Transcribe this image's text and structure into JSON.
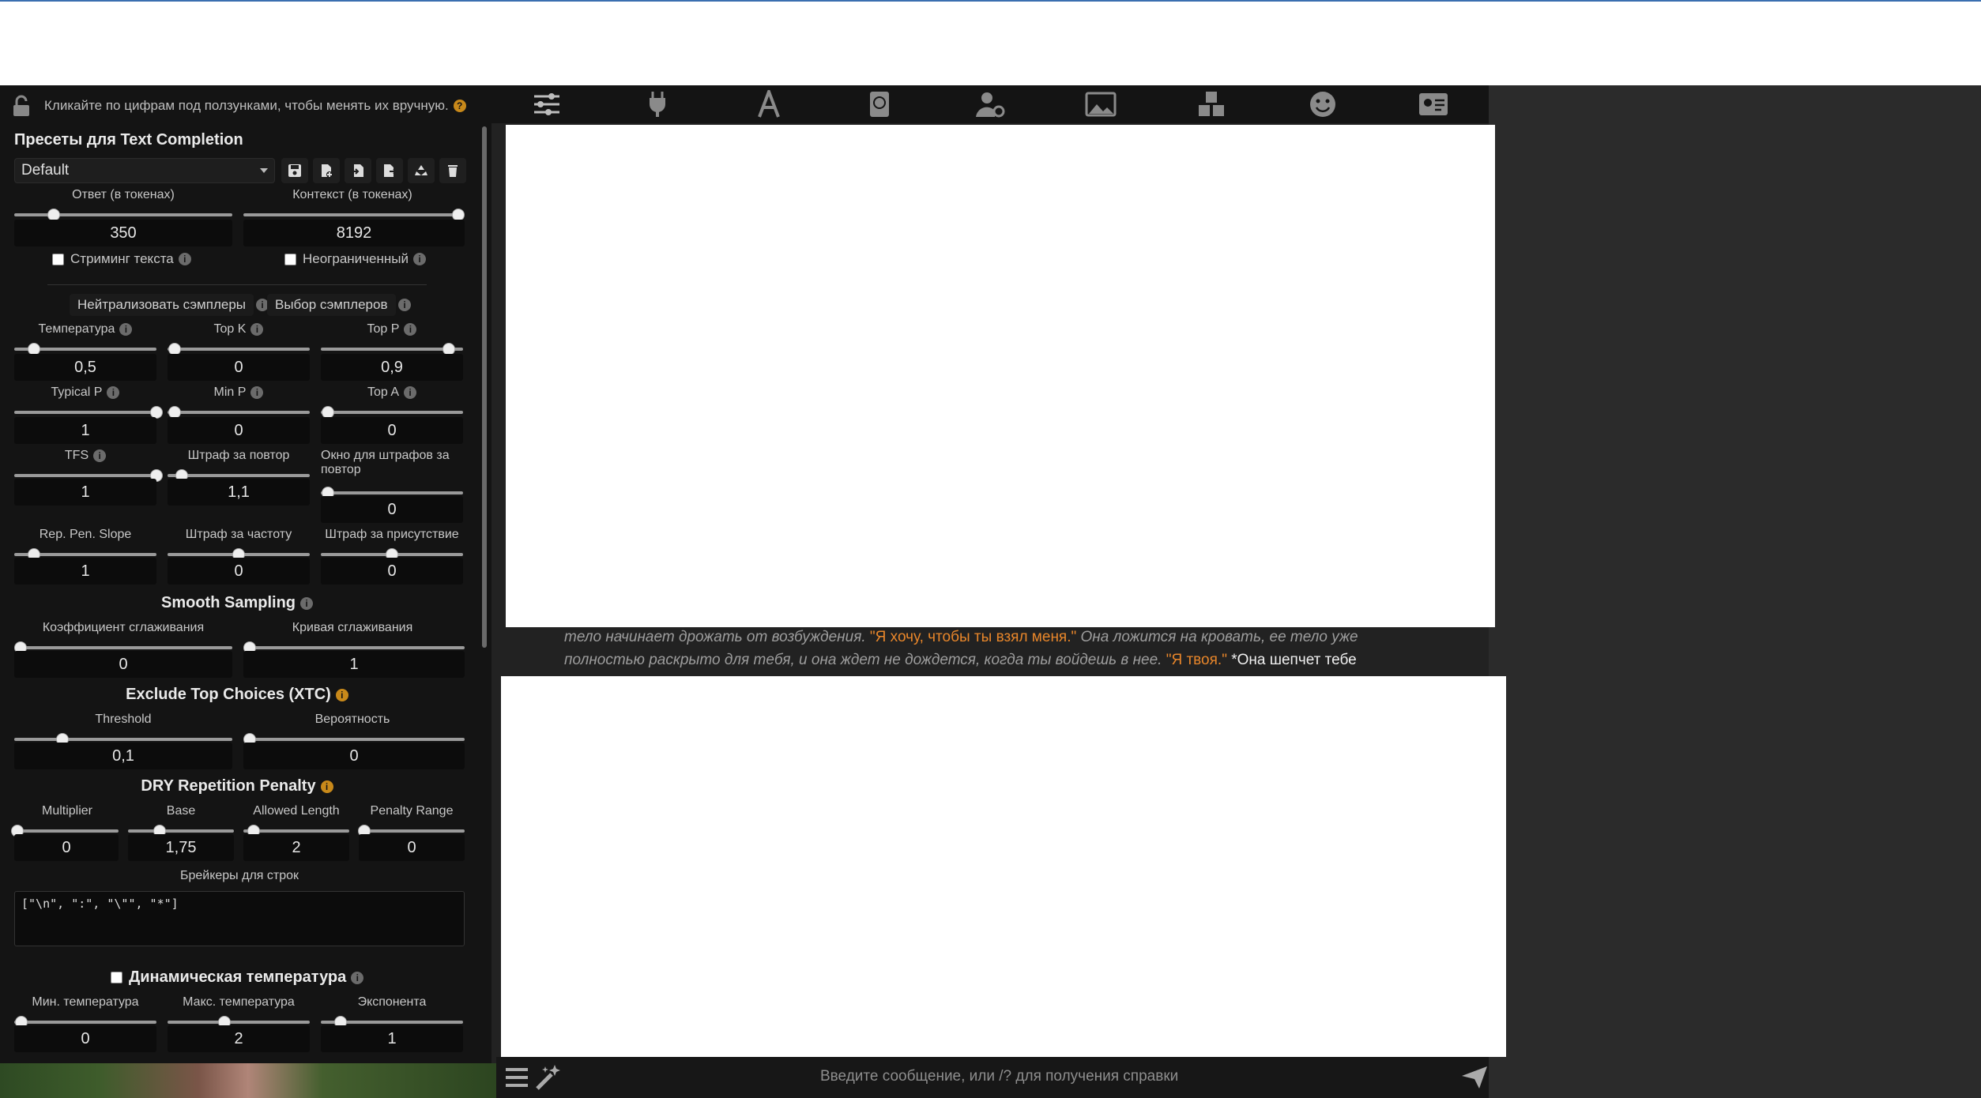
{
  "panel": {
    "hint": "Кликайте по цифрам под ползунками, чтобы менять их вручную.",
    "presets_title": "Пресеты для Text Completion",
    "preset_selected": "Default",
    "response_label": "Ответ (в токенах)",
    "response_value": "350",
    "context_label": "Контекст (в токенах)",
    "context_value": "8192",
    "streaming_label": "Стриминг текста",
    "unlimited_label": "Неограниченный",
    "neutralize_label": "Нейтрализовать сэмплеры",
    "sampler_select_label": "Выбор сэмплеров",
    "temperature_label": "Температура",
    "temperature_value": "0,5",
    "topk_label": "Top K",
    "topk_value": "0",
    "topp_label": "Top P",
    "topp_value": "0,9",
    "typicalp_label": "Typical P",
    "typicalp_value": "1",
    "minp_label": "Min P",
    "minp_value": "0",
    "topa_label": "Top A",
    "topa_value": "0",
    "tfs_label": "TFS",
    "tfs_value": "1",
    "reppen_label": "Штраф за повтор",
    "reppen_value": "1,1",
    "reppen_window_label": "Окно для штрафов за повтор",
    "reppen_window_value": "0",
    "reppen_slope_label": "Rep. Pen. Slope",
    "reppen_slope_value": "1",
    "freq_label": "Штраф за частоту",
    "freq_value": "0",
    "presence_label": "Штраф за присутствие",
    "presence_value": "0",
    "smooth_title": "Smooth Sampling",
    "smooth_factor_label": "Коэффициент сглаживания",
    "smooth_factor_value": "0",
    "smooth_curve_label": "Кривая сглаживания",
    "smooth_curve_value": "1",
    "xtc_title": "Exclude Top Choices (XTC)",
    "threshold_label": "Threshold",
    "threshold_value": "0,1",
    "probability_label": "Вероятность",
    "probability_value": "0",
    "dry_title": "DRY Repetition Penalty",
    "multiplier_label": "Multiplier",
    "multiplier_value": "0",
    "base_label": "Base",
    "base_value": "1,75",
    "allowed_label": "Allowed Length",
    "allowed_value": "2",
    "range_label": "Penalty Range",
    "range_value": "0",
    "breakers_label": "Брейкеры для строк",
    "breakers_value": "[\"\\n\", \":\", \"\\\"\", \"*\"]",
    "dyntemp_label": "Динамическая температура",
    "mintemp_label": "Мин. температура",
    "mintemp_value": "0",
    "maxtemp_label": "Макс. температура",
    "maxtemp_value": "2",
    "exponent_label": "Экспонента",
    "exponent_value": "1"
  },
  "sliders": {
    "response": 0.18,
    "context": 1.0,
    "temperature": 0.14,
    "topk": 0.05,
    "topp": 0.9,
    "typicalp": 1.0,
    "minp": 0.05,
    "topa": 0.05,
    "tfs": 1.0,
    "reppen": 0.1,
    "reppen_window": 0.05,
    "reppen_slope": 0.14,
    "freq": 0.5,
    "presence": 0.5,
    "smooth_factor": 0.03,
    "smooth_curve": 0.03,
    "threshold": 0.22,
    "probability": 0.03,
    "multiplier": 0.03,
    "base": 0.3,
    "allowed": 0.1,
    "range": 0.05,
    "mintemp": 0.05,
    "maxtemp": 0.4,
    "exponent": 0.14
  },
  "message": {
    "p1": "тело начинает дрожать от возбуждения. ",
    "q1": "\"Я хочу, чтобы ты взял меня.\"",
    "p2": " Она ложится на кровать, ее тело уже полностью раскрыто для тебя, и она ждет не дождется, когда ты войдешь в нее. ",
    "q2": "\"Я твоя.\"",
    "p3": " *Она шепчет тебе"
  },
  "input": {
    "placeholder": "Введите сообщение, или /? для получения справки"
  },
  "nav_icons": [
    "sliders-icon",
    "plug-icon",
    "font-icon",
    "book-icon",
    "user-gear-icon",
    "image-icon",
    "cubes-icon",
    "smile-icon",
    "id-card-icon"
  ],
  "colors": {
    "accent_orange": "#e8862a",
    "panel_bg": "#141414"
  }
}
